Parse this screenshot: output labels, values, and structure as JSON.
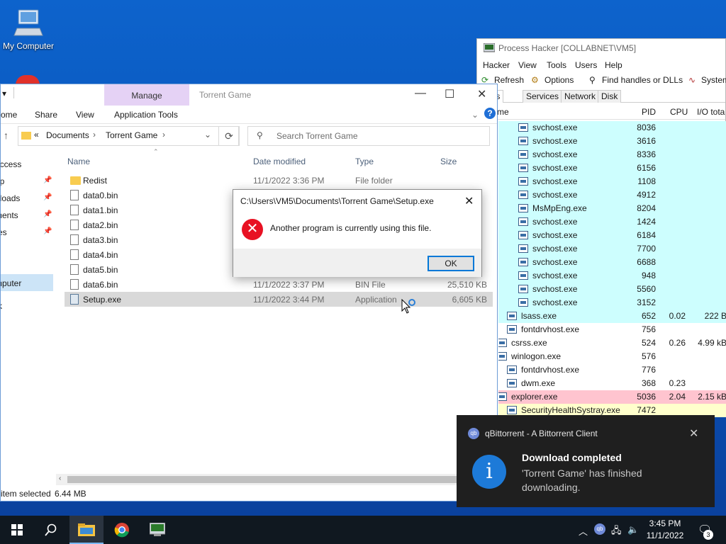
{
  "desktop": {
    "icon_label": "My Computer"
  },
  "process_hacker": {
    "title": "Process Hacker [COLLABNET\\VM5]",
    "menu": [
      "Hacker",
      "View",
      "Tools",
      "Users",
      "Help"
    ],
    "toolbar": {
      "refresh": "Refresh",
      "options": "Options",
      "find": "Find handles or DLLs",
      "system": "System"
    },
    "tabs": [
      "esses",
      "Services",
      "Network",
      "Disk"
    ],
    "columns": {
      "name": "me",
      "pid": "PID",
      "cpu": "CPU",
      "io": "I/O tota"
    },
    "rows": [
      {
        "name": "svchost.exe",
        "pid": "8036",
        "cpu": "",
        "io": ""
      },
      {
        "name": "svchost.exe",
        "pid": "3616",
        "cpu": "",
        "io": ""
      },
      {
        "name": "svchost.exe",
        "pid": "8336",
        "cpu": "",
        "io": ""
      },
      {
        "name": "svchost.exe",
        "pid": "6156",
        "cpu": "",
        "io": ""
      },
      {
        "name": "svchost.exe",
        "pid": "1108",
        "cpu": "",
        "io": ""
      },
      {
        "name": "svchost.exe",
        "pid": "4912",
        "cpu": "",
        "io": ""
      },
      {
        "name": "MsMpEng.exe",
        "pid": "8204",
        "cpu": "",
        "io": ""
      },
      {
        "name": "svchost.exe",
        "pid": "1424",
        "cpu": "",
        "io": ""
      },
      {
        "name": "svchost.exe",
        "pid": "6184",
        "cpu": "",
        "io": ""
      },
      {
        "name": "svchost.exe",
        "pid": "7700",
        "cpu": "",
        "io": ""
      },
      {
        "name": "svchost.exe",
        "pid": "6688",
        "cpu": "",
        "io": ""
      },
      {
        "name": "svchost.exe",
        "pid": "948",
        "cpu": "",
        "io": ""
      },
      {
        "name": "svchost.exe",
        "pid": "5560",
        "cpu": "",
        "io": ""
      },
      {
        "name": "svchost.exe",
        "pid": "3152",
        "cpu": "",
        "io": ""
      },
      {
        "name": "lsass.exe",
        "pid": "652",
        "cpu": "0.02",
        "io": "222 B"
      },
      {
        "name": "fontdrvhost.exe",
        "pid": "756",
        "cpu": "",
        "io": ""
      },
      {
        "name": "csrss.exe",
        "pid": "524",
        "cpu": "0.26",
        "io": "4.99 kB"
      },
      {
        "name": "winlogon.exe",
        "pid": "576",
        "cpu": "",
        "io": ""
      },
      {
        "name": "fontdrvhost.exe",
        "pid": "776",
        "cpu": "",
        "io": ""
      },
      {
        "name": "dwm.exe",
        "pid": "368",
        "cpu": "0.23",
        "io": ""
      },
      {
        "name": "explorer.exe",
        "pid": "5036",
        "cpu": "2.04",
        "io": "2.15 kB"
      },
      {
        "name": "SecurityHealthSystray.exe",
        "pid": "7472",
        "cpu": "",
        "io": ""
      }
    ],
    "colors": {
      "service": "#cdfefe",
      "explorer": "#ffc4cf",
      "yellow": "#ffffcc"
    }
  },
  "explorer": {
    "manage_tab": "Manage",
    "title": "Torrent Game",
    "ribbon": {
      "home": "ome",
      "share": "Share",
      "view": "View",
      "app_tools": "Application Tools"
    },
    "breadcrumb": {
      "root": "«",
      "documents": "Documents",
      "folder": "Torrent Game"
    },
    "search_placeholder": "Search Torrent Game",
    "nav": [
      {
        "label": "access",
        "pin": false
      },
      {
        "label": "op",
        "pin": true
      },
      {
        "label": "aloads",
        "pin": true
      },
      {
        "label": "ments",
        "pin": true
      },
      {
        "label": "res",
        "pin": true
      },
      {
        "label": "c",
        "pin": false
      },
      {
        "label": "s",
        "pin": false
      },
      {
        "label": "mputer",
        "pin": false
      },
      {
        "label": "rk",
        "pin": false
      }
    ],
    "columns": {
      "name": "Name",
      "date": "Date modified",
      "type": "Type",
      "size": "Size"
    },
    "files": [
      {
        "name": "Redist",
        "date": "11/1/2022 3:36 PM",
        "type": "File folder",
        "size": "",
        "icon": "folder"
      },
      {
        "name": "data0.bin",
        "date": "",
        "type": "",
        "size": "",
        "icon": "file"
      },
      {
        "name": "data1.bin",
        "date": "",
        "type": "",
        "size": "",
        "icon": "file"
      },
      {
        "name": "data2.bin",
        "date": "",
        "type": "",
        "size": "",
        "icon": "file"
      },
      {
        "name": "data3.bin",
        "date": "",
        "type": "",
        "size": "",
        "icon": "file"
      },
      {
        "name": "data4.bin",
        "date": "",
        "type": "",
        "size": "",
        "icon": "file"
      },
      {
        "name": "data5.bin",
        "date": "",
        "type": "",
        "size": "",
        "icon": "file"
      },
      {
        "name": "data6.bin",
        "date": "11/1/2022 3:37 PM",
        "type": "BIN File",
        "size": "25,510 KB",
        "icon": "file"
      },
      {
        "name": "Setup.exe",
        "date": "11/1/2022 3:44 PM",
        "type": "Application",
        "size": "6,605 KB",
        "icon": "app"
      }
    ],
    "status": {
      "selected": "item selected",
      "size": "6.44 MB"
    }
  },
  "dialog": {
    "title": "C:\\Users\\VM5\\Documents\\Torrent Game\\Setup.exe",
    "message": "Another program is currently using this file.",
    "ok": "OK"
  },
  "toast": {
    "app": "qBittorrent - A Bittorrent Client",
    "app_icon_text": "qb",
    "title": "Download completed",
    "body": "'Torrent Game' has finished downloading."
  },
  "taskbar": {
    "time": "3:45 PM",
    "date": "11/1/2022",
    "notifications": "3"
  }
}
